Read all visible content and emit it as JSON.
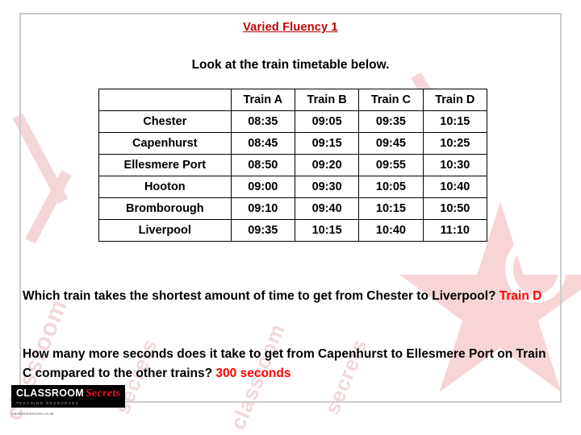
{
  "slide": {
    "title": "Varied Fluency 1",
    "subtitle": "Look at the train timetable below."
  },
  "timetable": {
    "corner_label": "",
    "columns": [
      "Train A",
      "Train B",
      "Train C",
      "Train D"
    ],
    "rows": [
      {
        "station": "Chester",
        "times": [
          "08:35",
          "09:05",
          "09:35",
          "10:15"
        ]
      },
      {
        "station": "Capenhurst",
        "times": [
          "08:45",
          "09:15",
          "09:45",
          "10:25"
        ]
      },
      {
        "station": "Ellesmere Port",
        "times": [
          "08:50",
          "09:20",
          "09:55",
          "10:30"
        ]
      },
      {
        "station": "Hooton",
        "times": [
          "09:00",
          "09:30",
          "10:05",
          "10:40"
        ]
      },
      {
        "station": "Bromborough",
        "times": [
          "09:10",
          "09:40",
          "10:15",
          "10:50"
        ]
      },
      {
        "station": "Liverpool",
        "times": [
          "09:35",
          "10:15",
          "10:40",
          "11:10"
        ]
      }
    ]
  },
  "questions": [
    {
      "text": "Which train takes the shortest amount of time to get from Chester to Liverpool? ",
      "answer": "Train D"
    },
    {
      "text": "How many more seconds does it take to get from Capenhurst to Ellesmere Port on Train C compared to the other trains? ",
      "answer": "300 seconds"
    }
  ],
  "logo": {
    "word1": "CLASSROOM",
    "word2": "Secrets",
    "tagline": "TEACHING RESOURCES",
    "caption": "classroomsecrets.co.uk"
  },
  "watermark": {
    "words": [
      "classroom",
      "secrets",
      "classroom",
      "secrets"
    ]
  },
  "colors": {
    "title": "#c00000",
    "answer": "#ff0000",
    "border": "#000000",
    "frame": "#cccccc"
  }
}
